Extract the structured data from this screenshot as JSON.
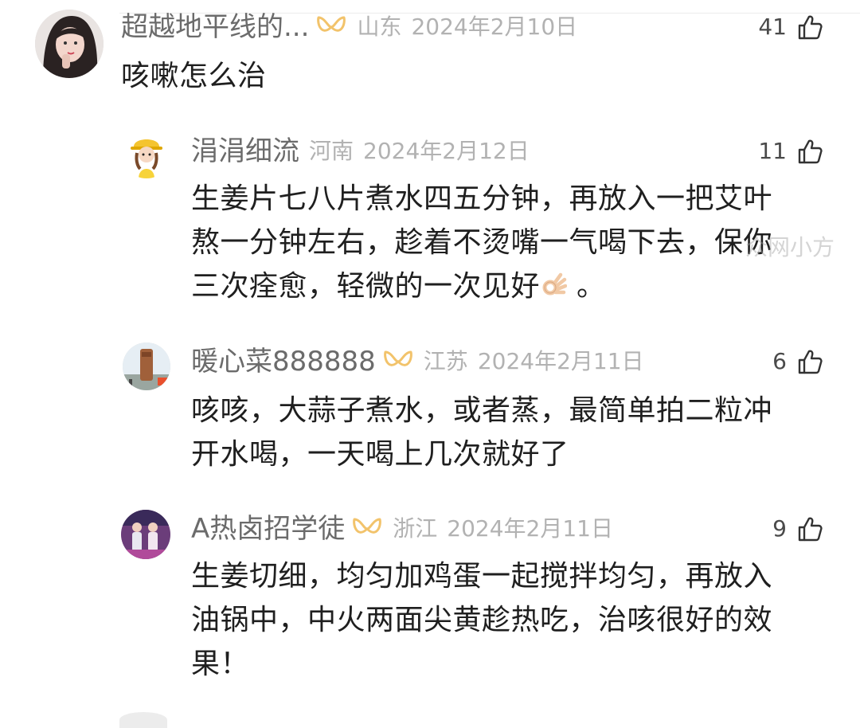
{
  "watermark": "众网小方",
  "colors": {
    "username": "#6b6b6b",
    "meta": "#b2b2b2",
    "body": "#1f1f1f",
    "vip_badge": "#f2c36b"
  },
  "comments": [
    {
      "username": "超越地平线的...",
      "vip": true,
      "location": "山东",
      "date": "2024年2月10日",
      "likes": "41",
      "text": "咳嗽怎么治",
      "avatar_icon": "woman-portrait-avatar"
    },
    {
      "username": "涓涓细流",
      "vip": false,
      "location": "河南",
      "date": "2024年2月12日",
      "likes": "11",
      "text_lines": [
        "生姜片七八片煮水四五分钟，再放入一把艾叶",
        "熬一分钟左右，趁着不烫嘴一气喝下去，保你",
        "三次痊愈，轻微的一次见好"
      ],
      "text_suffix": "。",
      "avatar_icon": "cartoon-girl-avatar"
    },
    {
      "username": "暖心菜888888",
      "vip": true,
      "location": "江苏",
      "date": "2024年2月11日",
      "likes": "6",
      "text_lines": [
        "咳咳，大蒜子煮水，或者蒸，最简单拍二粒冲",
        "开水喝，一天喝上几次就好了"
      ],
      "avatar_icon": "statue-avatar"
    },
    {
      "username": "A热卤招学徒",
      "vip": true,
      "location": "浙江",
      "date": "2024年2月11日",
      "likes": "9",
      "text_lines": [
        "生姜切细，均匀加鸡蛋一起搅拌均匀，再放入",
        "油锅中，中火两面尖黄趁热吃，治咳很好的效",
        "果！"
      ],
      "avatar_icon": "group-photo-avatar"
    }
  ]
}
